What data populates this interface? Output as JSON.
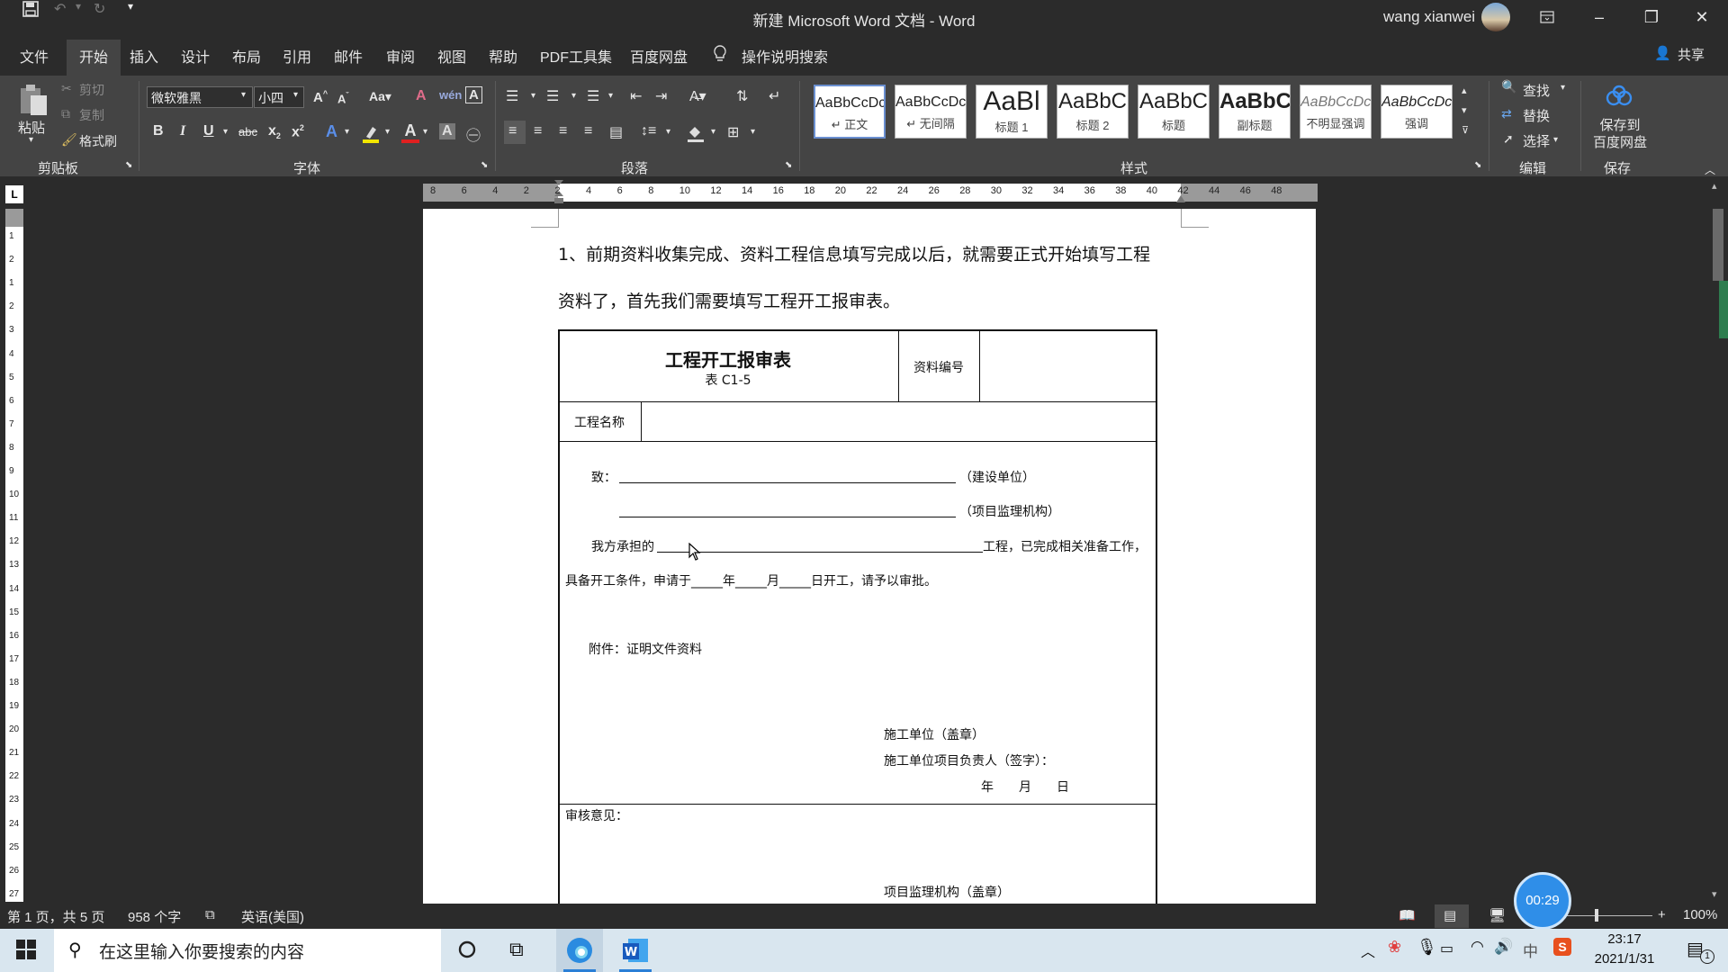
{
  "titlebar": {
    "doc_title": "新建 Microsoft Word 文档 - Word",
    "user_name": "wang xianwei"
  },
  "tabs": [
    "文件",
    "开始",
    "插入",
    "设计",
    "布局",
    "引用",
    "邮件",
    "审阅",
    "视图",
    "帮助",
    "PDF工具集",
    "百度网盘"
  ],
  "tell_me": "操作说明搜索",
  "share": "共享",
  "ribbon": {
    "clipboard": {
      "paste": "粘贴",
      "cut": "剪切",
      "copy": "复制",
      "format_painter": "格式刷",
      "label": "剪贴板"
    },
    "font": {
      "name": "微软雅黑",
      "size": "小四",
      "label": "字体"
    },
    "paragraph": {
      "label": "段落"
    },
    "styles": {
      "label": "样式",
      "items": [
        {
          "sample": "AaBbCcDc",
          "name": "↵ 正文"
        },
        {
          "sample": "AaBbCcDc",
          "name": "↵ 无间隔"
        },
        {
          "sample": "AaBl",
          "name": "标题 1"
        },
        {
          "sample": "AaBbC",
          "name": "标题 2"
        },
        {
          "sample": "AaBbC",
          "name": "标题"
        },
        {
          "sample": "AaBbC",
          "name": "副标题"
        },
        {
          "sample": "AaBbCcDc",
          "name": "不明显强调"
        },
        {
          "sample": "AaBbCcDc",
          "name": "强调"
        }
      ]
    },
    "editing": {
      "find": "查找",
      "replace": "替换",
      "select": "选择",
      "label": "编辑"
    },
    "save": {
      "button": "保存到\n百度网盘",
      "label": "保存"
    }
  },
  "ruler": {
    "h_ticks": [
      "8",
      "6",
      "4",
      "2",
      "2",
      "4",
      "6",
      "8",
      "10",
      "12",
      "14",
      "16",
      "18",
      "20",
      "22",
      "24",
      "26",
      "28",
      "30",
      "32",
      "34",
      "36",
      "38",
      "40",
      "42",
      "44",
      "46",
      "48"
    ],
    "v_ticks": [
      "1",
      "2",
      "1",
      "2",
      "3",
      "4",
      "5",
      "6",
      "7",
      "8",
      "9",
      "10",
      "11",
      "12",
      "13",
      "14",
      "15",
      "16",
      "17",
      "18",
      "19",
      "20",
      "21",
      "22",
      "23",
      "24",
      "25",
      "26",
      "27",
      "28"
    ],
    "corner": "L"
  },
  "document": {
    "para1": "1、前期资料收集完成、资料工程信息填写完成以后，就需要正式开始填写工程",
    "para2": "资料了，首先我们需要填写工程开工报审表。",
    "form": {
      "title": "工程开工报审表",
      "subtitle": "表 C1-5",
      "doc_no_label": "资料编号",
      "project_name_label": "工程名称",
      "to_label": "致：",
      "owner_suffix": "（建设单位）",
      "supervisor_suffix": "（项目监理机构）",
      "line1_prefix": "我方承担的",
      "line1_suffix": "工程，已完成相关准备工作，",
      "line2": "具备开工条件，申请于_____年_____月_____日开工，请予以审批。",
      "attachment": "附件：证明文件资料",
      "contractor_seal": "施工单位（盖章）",
      "contractor_sign": "施工单位项目负责人（签字）：",
      "date": "年　　月　　日",
      "review_label": "审核意见：",
      "supervisor_seal": "项目监理机构（盖章）"
    }
  },
  "statusbar": {
    "page": "第 1 页，共 5 页",
    "words": "958 个字",
    "language": "英语(美国)",
    "zoom": "100%",
    "timer": "00:29"
  },
  "taskbar": {
    "search_placeholder": "在这里输入你要搜索的内容",
    "time": "23:17",
    "date": "2021/1/31",
    "ime": "中",
    "notif_count": "1"
  }
}
